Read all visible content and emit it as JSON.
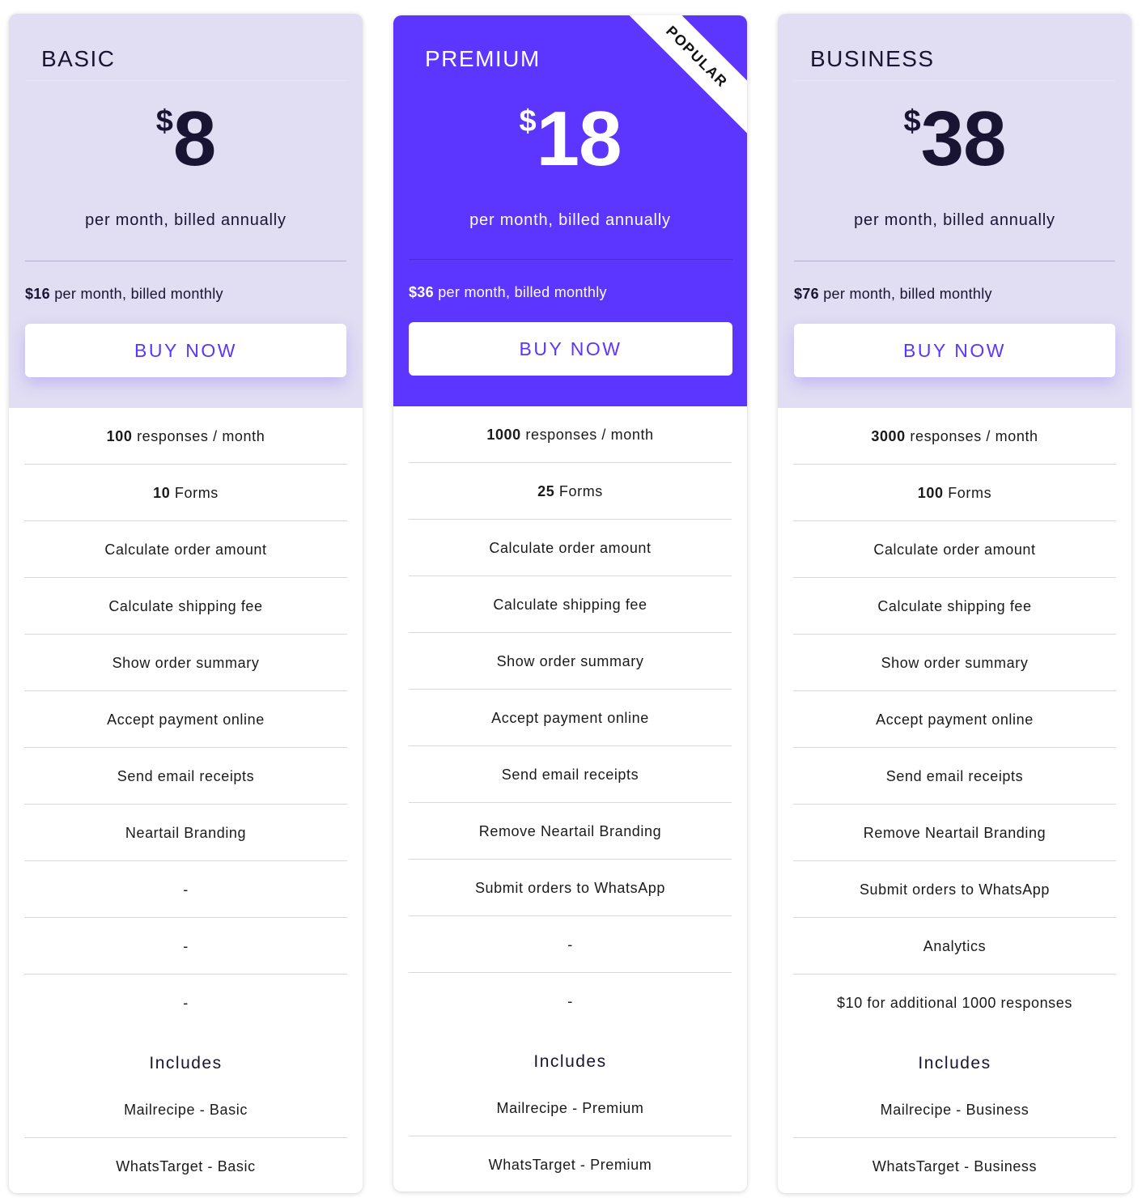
{
  "colors": {
    "accent": "#5c35fe",
    "card_head_bg": "#e1ddf3",
    "text_dark": "#1a1433"
  },
  "plans": [
    {
      "name": "BASIC",
      "currency": "$",
      "price": "8",
      "annual_note": "per month, billed annually",
      "monthly_price": "$16",
      "monthly_note": " per month, billed monthly",
      "button_label": "BUY NOW",
      "features": [
        {
          "bold": "100",
          "text": " responses / month"
        },
        {
          "bold": "10",
          "text": " Forms"
        },
        {
          "bold": "",
          "text": "Calculate order amount"
        },
        {
          "bold": "",
          "text": "Calculate shipping fee"
        },
        {
          "bold": "",
          "text": "Show order summary"
        },
        {
          "bold": "",
          "text": "Accept payment online"
        },
        {
          "bold": "",
          "text": "Send email receipts"
        },
        {
          "bold": "",
          "text": "Neartail Branding"
        },
        {
          "bold": "",
          "text": "-"
        },
        {
          "bold": "",
          "text": "-"
        },
        {
          "bold": "",
          "text": "-"
        }
      ],
      "includes_title": "Includes",
      "includes": [
        "Mailrecipe - Basic",
        "WhatsTarget - Basic"
      ]
    },
    {
      "name": "PREMIUM",
      "badge": "POPULAR",
      "currency": "$",
      "price": "18",
      "annual_note": "per month, billed annually",
      "monthly_price": "$36",
      "monthly_note": " per month, billed monthly",
      "button_label": "BUY NOW",
      "features": [
        {
          "bold": "1000",
          "text": " responses / month"
        },
        {
          "bold": "25",
          "text": " Forms"
        },
        {
          "bold": "",
          "text": "Calculate order amount"
        },
        {
          "bold": "",
          "text": "Calculate shipping fee"
        },
        {
          "bold": "",
          "text": "Show order summary"
        },
        {
          "bold": "",
          "text": "Accept payment online"
        },
        {
          "bold": "",
          "text": "Send email receipts"
        },
        {
          "bold": "",
          "text": "Remove Neartail Branding"
        },
        {
          "bold": "",
          "text": "Submit orders to WhatsApp"
        },
        {
          "bold": "",
          "text": "-"
        },
        {
          "bold": "",
          "text": "-"
        }
      ],
      "includes_title": "Includes",
      "includes": [
        "Mailrecipe - Premium",
        "WhatsTarget - Premium"
      ]
    },
    {
      "name": "BUSINESS",
      "currency": "$",
      "price": "38",
      "annual_note": "per month, billed annually",
      "monthly_price": "$76",
      "monthly_note": " per month, billed monthly",
      "button_label": "BUY NOW",
      "features": [
        {
          "bold": "3000",
          "text": " responses / month"
        },
        {
          "bold": "100",
          "text": " Forms"
        },
        {
          "bold": "",
          "text": "Calculate order amount"
        },
        {
          "bold": "",
          "text": "Calculate shipping fee"
        },
        {
          "bold": "",
          "text": "Show order summary"
        },
        {
          "bold": "",
          "text": "Accept payment online"
        },
        {
          "bold": "",
          "text": "Send email receipts"
        },
        {
          "bold": "",
          "text": "Remove Neartail Branding"
        },
        {
          "bold": "",
          "text": "Submit orders to WhatsApp"
        },
        {
          "bold": "",
          "text": "Analytics"
        },
        {
          "bold": "",
          "text": "$10 for additional 1000 responses"
        }
      ],
      "includes_title": "Includes",
      "includes": [
        "Mailrecipe - Business",
        "WhatsTarget - Business"
      ]
    }
  ]
}
